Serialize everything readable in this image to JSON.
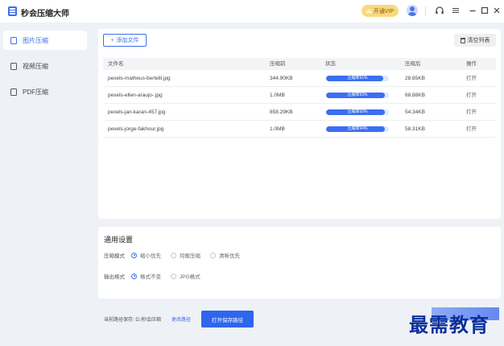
{
  "app": {
    "title": "秒会压缩大师"
  },
  "titlebar": {
    "vip_label": "开通VIP",
    "icons": [
      "headset-icon",
      "menu-icon",
      "minimize-icon",
      "maximize-icon",
      "close-icon"
    ]
  },
  "sidebar": {
    "items": [
      {
        "label": "图片压缩",
        "icon": "image-icon",
        "active": true
      },
      {
        "label": "视频压缩",
        "icon": "video-icon",
        "active": false
      },
      {
        "label": "PDF压缩",
        "icon": "pdf-icon",
        "active": false
      }
    ]
  },
  "toolbar": {
    "add_label": "添加文件",
    "clear_label": "清空列表"
  },
  "table": {
    "headers": {
      "name": "文件名",
      "before": "压缩前",
      "status": "状态",
      "after": "压缩后",
      "op": "操作"
    },
    "rows": [
      {
        "name": "pexels-matheus-bertelli.jpg",
        "before": "344.90KB",
        "progress": 91,
        "status_text": "压缩率91%",
        "after": "28.85KB",
        "op": "打开"
      },
      {
        "name": "pexels-ellen-araujo-.jpg",
        "before": "1.0MB",
        "progress": 93,
        "status_text": "压缩率93%",
        "after": "68.88KB",
        "op": "打开"
      },
      {
        "name": "pexels-jan-karan-457.jpg",
        "before": "858.29KB",
        "progress": 93,
        "status_text": "压缩率93%",
        "after": "54.34KB",
        "op": "打开"
      },
      {
        "name": "pexels-jorge-fakhour.jpg",
        "before": "1.0MB",
        "progress": 94,
        "status_text": "压缩率94%",
        "after": "58.31KB",
        "op": "打开"
      }
    ]
  },
  "settings": {
    "title": "通用设置",
    "mode_label": "压缩模式",
    "mode_options": [
      {
        "label": "缩小优先",
        "selected": true
      },
      {
        "label": "均衡压缩",
        "selected": false
      },
      {
        "label": "清晰优先",
        "selected": false
      }
    ],
    "format_label": "输出格式",
    "format_options": [
      {
        "label": "格式不变",
        "selected": true
      },
      {
        "label": "JPG格式",
        "selected": false
      }
    ]
  },
  "footer": {
    "path_prefix": "当前路径保存:",
    "path_value": "D:/秒会压缩",
    "change_label": "更改路径",
    "open_label": "打开保存路径"
  },
  "watermark": {
    "text": "最需教育"
  },
  "colors": {
    "accent": "#3a6ff0",
    "vip": "#f9d97f"
  }
}
